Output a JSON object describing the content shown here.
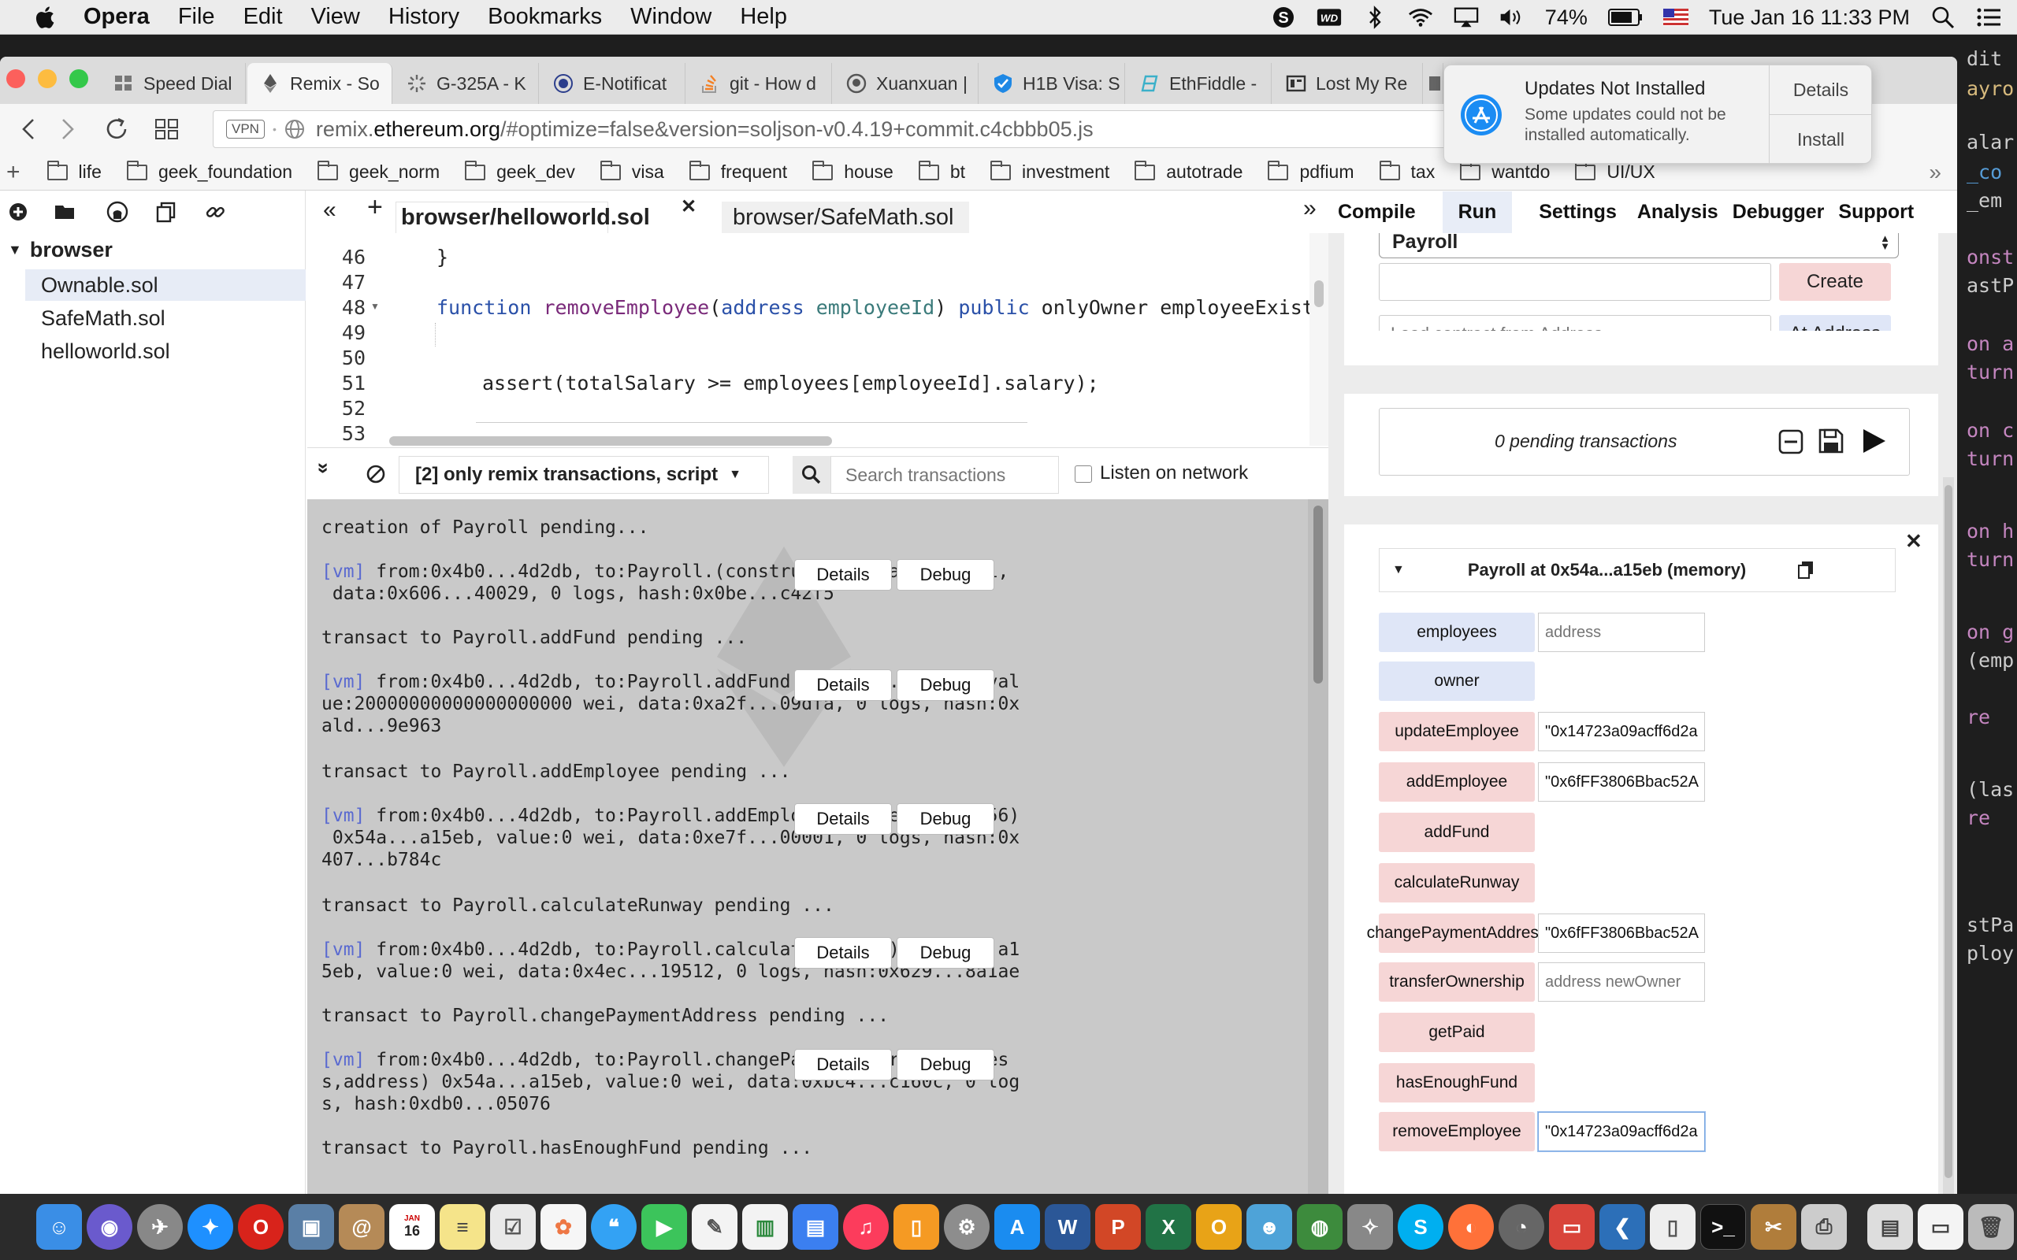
{
  "menubar": {
    "app": "Opera",
    "items": [
      "File",
      "Edit",
      "View",
      "History",
      "Bookmarks",
      "Window",
      "Help"
    ],
    "battery": "74%",
    "datetime": "Tue Jan 16  11:33 PM"
  },
  "tabs": [
    {
      "label": "Speed Dial",
      "icon": "grid-icon"
    },
    {
      "label": "Remix - So",
      "icon": "remix-icon"
    },
    {
      "label": "G-325A - K",
      "icon": "loading-icon"
    },
    {
      "label": "E-Notificat",
      "icon": "seal-icon"
    },
    {
      "label": "git - How d",
      "icon": "stackoverflow-icon"
    },
    {
      "label": "Xuanxuan |",
      "icon": "github-icon"
    },
    {
      "label": "H1B Visa: S",
      "icon": "check-icon"
    },
    {
      "label": "EthFiddle -",
      "icon": "ethfiddle-icon"
    },
    {
      "label": "Lost My Re",
      "icon": "page-icon"
    }
  ],
  "address": {
    "vpn": "VPN",
    "url_prefix": "remix.",
    "url_domain": "ethereum.org",
    "url_rest": "/#optimize=false&version=soljson-v0.4.19+commit.c4cbbb05.js"
  },
  "bookmarks": [
    "life",
    "geek_foundation",
    "geek_norm",
    "geek_dev",
    "visa",
    "frequent",
    "house",
    "bt",
    "investment",
    "autotrade",
    "pdfium",
    "tax",
    "wantdo",
    "UI/UX"
  ],
  "notification": {
    "title": "Updates Not Installed",
    "body": "Some updates could not be installed automatically.",
    "details": "Details",
    "install": "Install"
  },
  "filetree": {
    "root": "browser",
    "files": [
      "Ownable.sol",
      "SafeMath.sol",
      "helloworld.sol"
    ]
  },
  "editor": {
    "tabs": [
      "browser/helloworld.sol",
      "browser/SafeMath.sol"
    ],
    "line_numbers": [
      "46",
      "47",
      "48",
      "49",
      "50",
      "51",
      "52",
      "53"
    ],
    "line46": "}",
    "line48_kw1": "function",
    "line48_name": "removeEmployee",
    "line48_p1": "(",
    "line48_kw2": "address",
    "line48_param": "employeeId",
    "line48_p2": ") ",
    "line48_kw3": "public",
    "line48_rest": " onlyOwner employeeExists(e",
    "line52": "assert(totalSalary >= employees[employeeId].salary);"
  },
  "terminal": {
    "filter": "[2] only remix transactions, script",
    "search_placeholder": "Search transactions",
    "listen": "Listen on network",
    "details": "Details",
    "debug": "Debug",
    "entries": [
      {
        "pending": "creation of Payroll pending...",
        "vm": "[vm]",
        "l1": " from:0x4b0...4d2db, to:Payroll.(constructor), value:0 wei,",
        "l2": " data:0x606...40029, 0 logs, hash:0x0be...c42f5",
        "l3": ""
      },
      {
        "pending": "transact to Payroll.addFund pending ...",
        "vm": "[vm]",
        "l1": " from:0x4b0...4d2db, to:Payroll.addFund() 0x54a...a15eb, val",
        "l2": "ue:20000000000000000000 wei, data:0xa2f...09dfa, 0 logs, hash:0x",
        "l3": "ald...9e963"
      },
      {
        "pending": "transact to Payroll.addEmployee pending ...",
        "vm": "[vm]",
        "l1": " from:0x4b0...4d2db, to:Payroll.addEmployee(address,uint256)",
        "l2": " 0x54a...a15eb, value:0 wei, data:0xe7f...00001, 0 logs, hash:0x",
        "l3": "407...b784c"
      },
      {
        "pending": "transact to Payroll.calculateRunway pending ...",
        "vm": "[vm]",
        "l1": " from:0x4b0...4d2db, to:Payroll.calculateRunway() 0x54a...a1",
        "l2": "5eb, value:0 wei, data:0x4ec...19512, 0 logs, hash:0x629...8a1ae",
        "l3": ""
      },
      {
        "pending": "transact to Payroll.changePaymentAddress pending ...",
        "vm": "[vm]",
        "l1": " from:0x4b0...4d2db, to:Payroll.changePaymentAddress(addres",
        "l2": "s,address) 0x54a...a15eb, value:0 wei, data:0xbc4...c160c, 0 log",
        "l3": "s, hash:0xdb0...05076"
      }
    ],
    "last_pending": "transact to Payroll.hasEnoughFund pending ..."
  },
  "runpanel": {
    "tabs": [
      "Compile",
      "Run",
      "Settings",
      "Analysis",
      "Debugger",
      "Support"
    ],
    "contract_select": "Payroll",
    "create": "Create",
    "load_placeholder": "Load contract from Address",
    "at_address": "At Address",
    "pending": "0 pending transactions",
    "instance_title": "Payroll at 0x54a...a15eb (memory)",
    "functions": [
      {
        "name": "employees",
        "style": "blue",
        "input": "address",
        "placeholder": true
      },
      {
        "name": "owner",
        "style": "blue",
        "input": null,
        "placeholder": false
      },
      {
        "name": "updateEmployee",
        "style": "red",
        "input": "\"0x14723a09acff6d2a",
        "placeholder": false
      },
      {
        "name": "addEmployee",
        "style": "red",
        "input": "\"0x6fFF3806Bbac52A",
        "placeholder": false
      },
      {
        "name": "addFund",
        "style": "red",
        "input": null,
        "placeholder": false
      },
      {
        "name": "calculateRunway",
        "style": "red",
        "input": null,
        "placeholder": false
      },
      {
        "name": "changePaymentAddress",
        "style": "red",
        "input": "\"0x6fFF3806Bbac52A",
        "placeholder": false
      },
      {
        "name": "transferOwnership",
        "style": "red",
        "input": "address newOwner",
        "placeholder": true
      },
      {
        "name": "getPaid",
        "style": "red",
        "input": null,
        "placeholder": false
      },
      {
        "name": "hasEnoughFund",
        "style": "red",
        "input": null,
        "placeholder": false
      },
      {
        "name": "removeEmployee",
        "style": "red",
        "input": "\"0x14723a09acff6d2a",
        "placeholder": false
      }
    ]
  },
  "desktop_code": [
    "dit",
    "ayro",
    "alar",
    "_co",
    "_em",
    "onst",
    "astP",
    "on a",
    "turn",
    "on c",
    "turn",
    "on h",
    "turn",
    "on g",
    "(emp",
    "re",
    "(las",
    "re",
    "stPa",
    "ploy"
  ],
  "dock_badge": "16",
  "colors": {
    "create_button": "#f6d6d6",
    "call_button": "#dfe6f7",
    "vm_tag": "#5a6ad0",
    "keyword": "#2a50a8"
  }
}
